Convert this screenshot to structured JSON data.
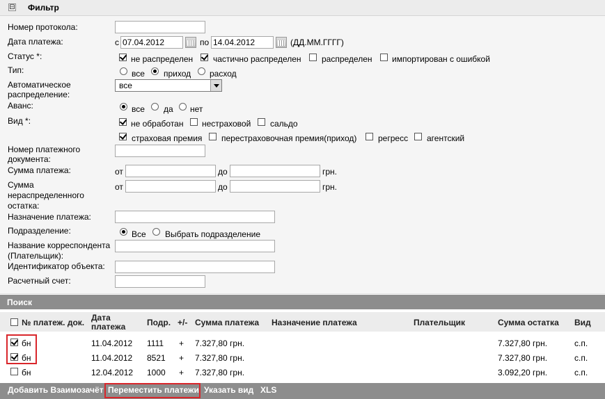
{
  "filter": {
    "toggle": "⊟",
    "title": "Фильтр",
    "protocol_label": "Номер протокола:",
    "date_label": "Дата платежа:",
    "date_from_prefix": "с",
    "date_from": "07.04.2012",
    "date_to_prefix": "по",
    "date_to": "14.04.2012",
    "date_format": "(ДД.ММ.ГГГГ)",
    "status_label": "Статус *:",
    "status_options": [
      {
        "label": "не распределен",
        "checked": true
      },
      {
        "label": "частично распределен",
        "checked": true
      },
      {
        "label": "распределен",
        "checked": false
      },
      {
        "label": "импортирован с ошибкой",
        "checked": false
      }
    ],
    "type_label": "Тип:",
    "type_options": [
      {
        "label": "все",
        "selected": false
      },
      {
        "label": "приход",
        "selected": true
      },
      {
        "label": "расход",
        "selected": false
      }
    ],
    "auto_label_1": "Автоматическое",
    "auto_label_2": "распределение:",
    "auto_value": "все",
    "advance_label": "Аванс:",
    "advance_options": [
      {
        "label": "все",
        "selected": true
      },
      {
        "label": "да",
        "selected": false
      },
      {
        "label": "нет",
        "selected": false
      }
    ],
    "kind_label": "Вид *:",
    "kind_options_1": [
      {
        "label": "не обработан",
        "checked": true
      },
      {
        "label": "нестраховой",
        "checked": false
      },
      {
        "label": "сальдо",
        "checked": false
      }
    ],
    "kind_options_2": [
      {
        "label": "страховая премия",
        "checked": true
      },
      {
        "label": "перестраховочная премия(приход)",
        "checked": false
      },
      {
        "label": "регресс",
        "checked": false
      },
      {
        "label": "агентский",
        "checked": false
      }
    ],
    "doc_label_1": "Номер платежного",
    "doc_label_2": "документа:",
    "sum_label": "Сумма платежа:",
    "from": "от",
    "to": "до",
    "currency": "грн.",
    "rem_label_1": "Сумма",
    "rem_label_2": "нераспределенного",
    "rem_label_3": "остатка:",
    "purpose_label": "Назначение платежа:",
    "division_label": "Подразделение:",
    "division_options": [
      {
        "label": "Все",
        "selected": true
      },
      {
        "label": "Выбрать подразделение",
        "selected": false
      }
    ],
    "corr_label_1": "Название корреспондента",
    "corr_label_2": "(Плательщик):",
    "object_label": "Идентификатор объекта:",
    "account_label": "Расчетный счет:"
  },
  "search": {
    "title": "Поиск"
  },
  "table": {
    "headers": {
      "doc": "№ платеж. док.",
      "date_1": "Дата",
      "date_2": "платежа",
      "div": "Подр.",
      "pm": "+/-",
      "sum": "Сумма платежа",
      "purpose": "Назначение платежа",
      "payer": "Плательщик",
      "rest": "Сумма остатка",
      "kind": "Вид"
    },
    "rows": [
      {
        "checked": true,
        "doc": "бн",
        "date": "11.04.2012",
        "div": "1111",
        "pm": "+",
        "sum": "7.327,80 грн.",
        "rest": "7.327,80 грн.",
        "kind": "с.п."
      },
      {
        "checked": true,
        "doc": "бн",
        "date": "11.04.2012",
        "div": "8521",
        "pm": "+",
        "sum": "7.327,80 грн.",
        "rest": "7.327,80 грн.",
        "kind": "с.п."
      },
      {
        "checked": false,
        "doc": "бн",
        "date": "12.04.2012",
        "div": "1000",
        "pm": "+",
        "sum": "7.327,80 грн.",
        "rest": "3.092,20 грн.",
        "kind": "с.п."
      }
    ]
  },
  "actions": {
    "add": "Добавить Взаимозачёт",
    "move": "Переместить платежи",
    "kind": "Указать вид",
    "xls": "XLS"
  }
}
